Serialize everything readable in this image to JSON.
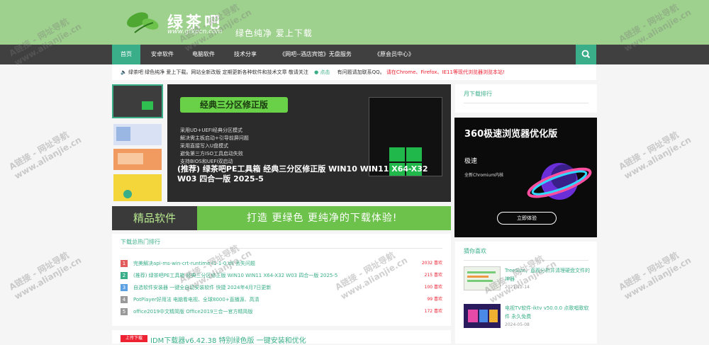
{
  "header": {
    "logo_text": "绿茶吧",
    "logo_url": "www.gtxpcn.com",
    "slogan": "绿色纯净 爱上下载"
  },
  "nav": {
    "items": [
      "首页",
      "安卓软件",
      "电脑软件",
      "技术分享",
      "《网吧--酒店宾馆》无盘服务",
      "《原会员中心》"
    ],
    "active_index": 0,
    "search_icon": "search-icon"
  },
  "notice": {
    "text_main": "绿茶吧 绿色纯净 爱上下载。网站全新改版 定期更新各种软件和技术文章 敬请关注",
    "text_click": "点击",
    "text_qq": "有问题请加联系QQ。",
    "text_red": "请在Chrome、Firefox、IE11等现代浏览器浏览本站!"
  },
  "banner": {
    "headline": "经典三分区修正版",
    "title": "(推荐) 绿茶吧PE工具箱 经典三分区修正版 WIN10 WIN11 X64-X32 W03 四合一版 2025-5",
    "features": [
      "采用UD+UEFI经典分区模式",
      "解决需主板启动+引导前屏问题",
      "采用直接写入U盘模式",
      "避免第三方ISO工具启动失败",
      "支持BIOS和UEFI双启动"
    ]
  },
  "ad_strip": {
    "left": "精品软件",
    "right": "打造 更绿色 更纯净的下载体验!"
  },
  "rank": {
    "title": "下载总热门排行",
    "items": [
      {
        "num": "1",
        "text": "完美解决api-ms-win-crt-runtime-l1-1-0.dll 丢失问题",
        "likes": "2032 喜欢",
        "color": "#e25b5b"
      },
      {
        "num": "2",
        "text": "(推荐) 绿茶吧PE工具箱 经典三分区修正版 WIN10 WIN11 X64-X32 W03 四合一版 2025-5",
        "likes": "215 喜欢",
        "color": "#3aae89"
      },
      {
        "num": "3",
        "text": "自选软件安装器 一键全自动安装软件 快捷 2024年4月7日更新",
        "likes": "100 喜欢",
        "color": "#5ba0e2"
      },
      {
        "num": "4",
        "text": "PotPlayer好用法 电脑看电视、全球8000+直播源、高清",
        "likes": "99 喜欢",
        "color": "#999999"
      },
      {
        "num": "5",
        "text": "office2019中文精简版 Office2019三合一官方精简版",
        "likes": "172 喜欢",
        "color": "#999999"
      }
    ]
  },
  "latest": {
    "tag": "上传下载",
    "title": "IDM下载器v6.42.38 特别绿色版 一键安装和优化"
  },
  "side": {
    "rank_title": "月下载排行",
    "ad": {
      "title": "360极速浏览器优化版",
      "sub1": "极速",
      "sub2": "全新Chromium内核",
      "button": "立即体验"
    },
    "like_title": "猜你喜欢",
    "likes": [
      {
        "title": "TreeSize，直观分析并清理硬盘文件的神器",
        "date": "2021-12-14"
      },
      {
        "title": "电视TV软件-iktv v50.0.0 点歌唱歌软件 永久免费",
        "date": "2024-05-08"
      }
    ]
  },
  "watermark": {
    "line1": "A链接 - 网址导航",
    "line2": "www.alianjie.cn"
  }
}
